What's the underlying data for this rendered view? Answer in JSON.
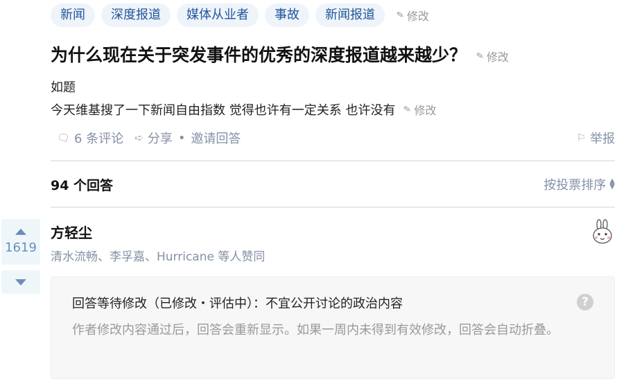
{
  "tags": [
    "新闻",
    "深度报道",
    "媒体从业者",
    "事故",
    "新闻报道"
  ],
  "edit_label": "修改",
  "question": {
    "title": "为什么现在关于突发事件的优秀的深度报道越来越少？",
    "detail_line1": "如题",
    "detail_line2": "今天维基搜了一下新闻自由指数 觉得也许有一定关系 也许没有"
  },
  "meta": {
    "comments": "6 条评论",
    "share": "分享",
    "separator": "•",
    "invite": "邀请回答",
    "report": "举报"
  },
  "answers_header": {
    "count": "94 个回答",
    "sort": "按投票排序"
  },
  "answer": {
    "votes": "1619",
    "author": "方轻尘",
    "voters": "清水流畅、李孚嘉、Hurricane 等人赞同",
    "notice_title": "回答等待修改（已修改・评估中）：不宜公开讨论的政治内容",
    "notice_help": "?",
    "notice_body": "作者修改内容通过后，回答会重新显示。如果一周内未得到有效修改，回答会自动折叠。"
  },
  "icons": {
    "edit": "pencil-icon",
    "comment": "comment-icon",
    "share": "share-icon",
    "report": "flag-icon",
    "sort": "sort-arrows-icon",
    "upvote": "upvote-icon",
    "downvote": "downvote-icon",
    "help": "help-icon"
  },
  "colors": {
    "tag_bg": "#eef4fa",
    "tag_text": "#225599",
    "vote_bg": "#eff6fa",
    "vote_text": "#698ebf",
    "meta_text": "#8590a6"
  }
}
